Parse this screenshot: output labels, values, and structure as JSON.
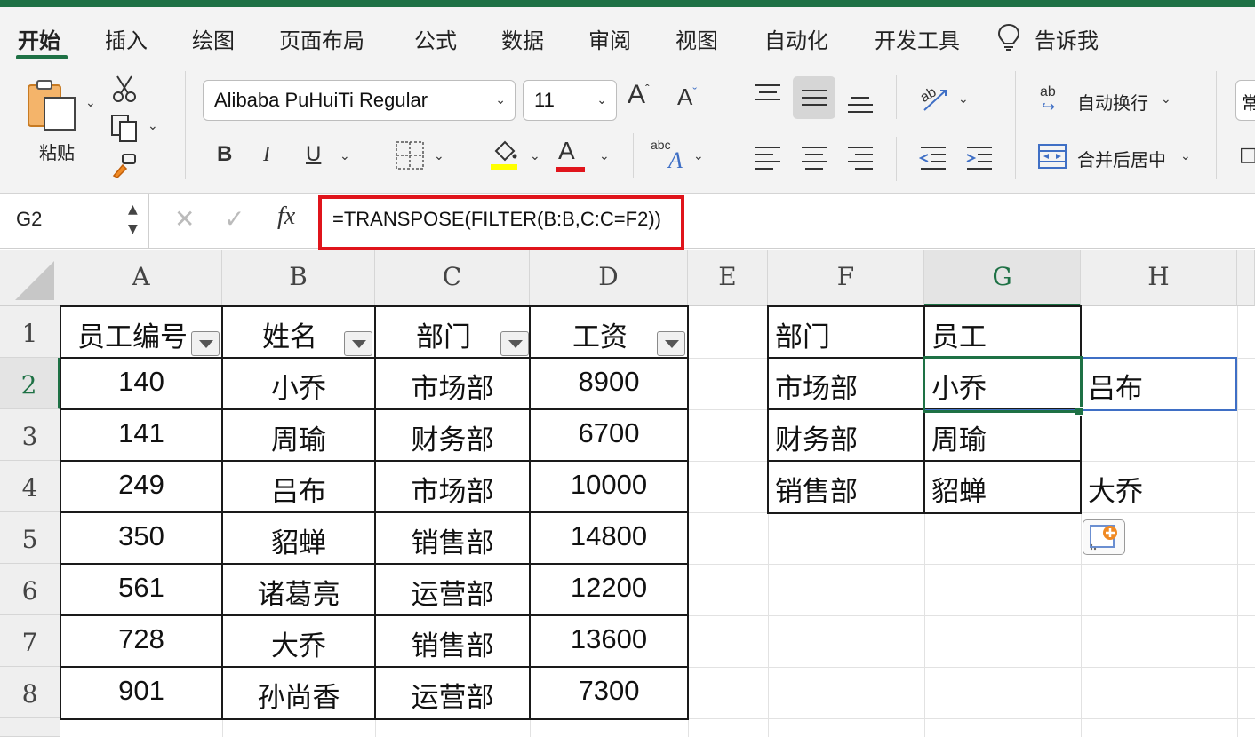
{
  "ribbon_tabs": [
    "开始",
    "插入",
    "绘图",
    "页面布局",
    "公式",
    "数据",
    "审阅",
    "视图",
    "自动化",
    "开发工具",
    "告诉我"
  ],
  "ribbon": {
    "paste_label": "粘贴",
    "font_name": "Alibaba PuHuiTi Regular",
    "font_size": "11",
    "grow_font": "A",
    "shrink_font": "A",
    "bold": "B",
    "italic": "I",
    "underline": "U",
    "font_color_letter": "A",
    "phonetic_top": "abc",
    "phonetic_letter": "A",
    "wrap_label": "自动换行",
    "wrap_icon_text": "ab",
    "merge_label": "合并后居中",
    "style_partial": "常",
    "highlight_color": "#ffff00",
    "font_color": "#e0141b"
  },
  "formula_bar": {
    "cell_ref": "G2",
    "fx_label": "fx",
    "formula": "=TRANSPOSE(FILTER(B:B,C:C=F2))",
    "highlight_color": "#e0141b"
  },
  "columns": [
    "A",
    "B",
    "C",
    "D",
    "E",
    "F",
    "G",
    "H"
  ],
  "rows": [
    "1",
    "2",
    "3",
    "4",
    "5",
    "6",
    "7",
    "8"
  ],
  "source_table": {
    "headers": [
      "员工编号",
      "姓名",
      "部门",
      "工资"
    ],
    "data": [
      [
        "140",
        "小乔",
        "市场部",
        "8900"
      ],
      [
        "141",
        "周瑜",
        "财务部",
        "6700"
      ],
      [
        "249",
        "吕布",
        "市场部",
        "10000"
      ],
      [
        "350",
        "貂蝉",
        "销售部",
        "14800"
      ],
      [
        "561",
        "诸葛亮",
        "运营部",
        "12200"
      ],
      [
        "728",
        "大乔",
        "销售部",
        "13600"
      ],
      [
        "901",
        "孙尚香",
        "运营部",
        "7300"
      ]
    ]
  },
  "result_table": {
    "headers": [
      "部门",
      "员工"
    ],
    "rows": [
      [
        "市场部",
        "小乔"
      ],
      [
        "财务部",
        "周瑜"
      ],
      [
        "销售部",
        "貂蝉"
      ]
    ]
  },
  "spill_cells": {
    "H2": "吕布",
    "H4": "大乔"
  },
  "selection": {
    "active_cell": "G2",
    "accent_color": "#1e7145"
  }
}
